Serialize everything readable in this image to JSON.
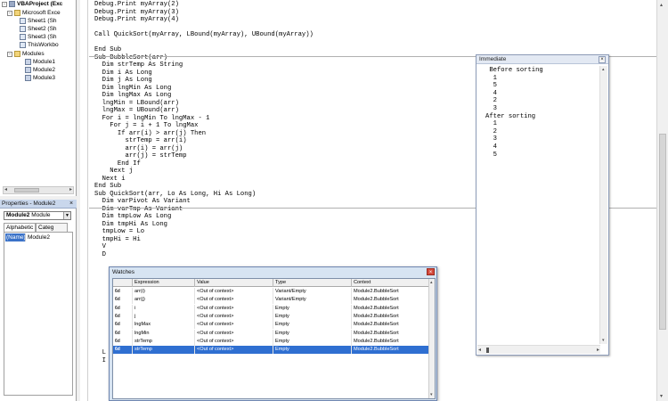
{
  "project": {
    "items": [
      {
        "label": "VBAProject (Exc",
        "icon": "vba-project-icon"
      },
      {
        "label": "Microsoft Exce",
        "icon": "folder-icon"
      },
      {
        "label": "Sheet1 (Sh",
        "icon": "sheet-icon"
      },
      {
        "label": "Sheet2 (Sh",
        "icon": "sheet-icon"
      },
      {
        "label": "Sheet3 (Sh",
        "icon": "sheet-icon"
      },
      {
        "label": "ThisWorkbo",
        "icon": "workbook-icon"
      },
      {
        "label": "Modules",
        "icon": "folder-icon"
      },
      {
        "label": "Module1",
        "icon": "module-icon"
      },
      {
        "label": "Module2",
        "icon": "module-icon"
      },
      {
        "label": "Module3",
        "icon": "module-icon"
      }
    ]
  },
  "properties": {
    "title": "Properties - Module2",
    "close": "×",
    "object_name": "Module2",
    "object_type": "Module",
    "tab_alpha": "Alphabetic",
    "tab_categ": "Categ",
    "prop_name": "(Name)",
    "prop_value": "Module2"
  },
  "code": {
    "text": "Debug.Print myArray(2)\nDebug.Print myArray(3)\nDebug.Print myArray(4)\n\nCall QuickSort(myArray, LBound(myArray), UBound(myArray))\n\nEnd Sub\nSub BubbleSort(arr)\n  Dim strTemp As String\n  Dim i As Long\n  Dim j As Long\n  Dim lngMin As Long\n  Dim lngMax As Long\n  lngMin = LBound(arr)\n  lngMax = UBound(arr)\n  For i = lngMin To lngMax - 1\n    For j = i + 1 To lngMax\n      If arr(i) > arr(j) Then\n        strTemp = arr(i)\n        arr(i) = arr(j)\n        arr(j) = strTemp\n      End If\n    Next j\n  Next i\nEnd Sub\nSub QuickSort(arr, Lo As Long, Hi As Long)\n  Dim varPivot As Variant\n  Dim varTmp As Variant\n  Dim tmpLow As Long\n  Dim tmpHi As Long\n  tmpLow = Lo\n  tmpHi = Hi\n  V\n  D\n\n\n\n\n\n\n\n\n\n\n\n\n  L\n  I"
  },
  "immediate": {
    "title": "Immediate",
    "close": "×",
    "output": " Before sorting\n  1\n  5\n  4\n  2\n  3\nAfter sorting\n  1\n  2\n  3\n  4\n  5"
  },
  "watches": {
    "title": "Watches",
    "close": "×",
    "headers": [
      "Expression",
      "Value",
      "Type",
      "Context"
    ],
    "rows": [
      {
        "icon": "6d",
        "expression": "arr(i)",
        "value": "<Out of context>",
        "type": "Variant/Empty",
        "context": "Module2.BubbleSort"
      },
      {
        "icon": "6d",
        "expression": "arr(j)",
        "value": "<Out of context>",
        "type": "Variant/Empty",
        "context": "Module2.BubbleSort"
      },
      {
        "icon": "6d",
        "expression": "i",
        "value": "<Out of context>",
        "type": "Empty",
        "context": "Module2.BubbleSort"
      },
      {
        "icon": "6d",
        "expression": "j",
        "value": "<Out of context>",
        "type": "Empty",
        "context": "Module2.BubbleSort"
      },
      {
        "icon": "6d",
        "expression": "lngMax",
        "value": "<Out of context>",
        "type": "Empty",
        "context": "Module2.BubbleSort"
      },
      {
        "icon": "6d",
        "expression": "lngMin",
        "value": "<Out of context>",
        "type": "Empty",
        "context": "Module2.BubbleSort"
      },
      {
        "icon": "6d",
        "expression": "strTemp",
        "value": "<Out of context>",
        "type": "Empty",
        "context": "Module2.BubbleSort"
      },
      {
        "icon": "6d",
        "expression": "strTemp",
        "value": "<Out of context>",
        "type": "Empty",
        "context": "Module2.BubbleSort"
      }
    ],
    "selected_row": 7
  },
  "colors": {
    "selection": "#2f6fd1",
    "watch_bg": "#d7e4f2",
    "close_red": "#d44a3c"
  }
}
